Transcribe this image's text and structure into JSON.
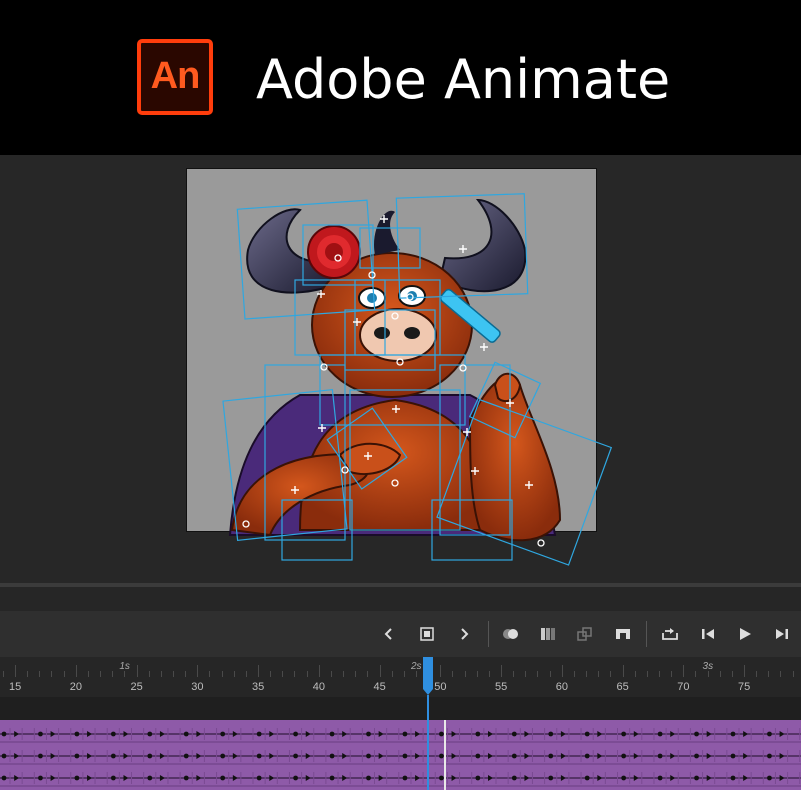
{
  "banner": {
    "logo_text": "An",
    "title": "Adobe Animate"
  },
  "toolbar": {
    "buttons": [
      "prev-frame-icon",
      "insert-keyframe-icon",
      "next-frame-icon",
      "onion-skin-icon",
      "edit-multiple-frames-icon",
      "sync-symbols-icon",
      "insert-frame-icon",
      "loop-icon",
      "step-back-icon",
      "play-icon",
      "step-forward-icon"
    ]
  },
  "timeline": {
    "seconds": [
      {
        "label": "1s",
        "frame": 24
      },
      {
        "label": "2s",
        "frame": 48
      },
      {
        "label": "3s",
        "frame": 72
      }
    ],
    "frame_labels": [
      "15",
      "20",
      "25",
      "30",
      "35",
      "40",
      "45",
      "50",
      "55",
      "60",
      "65",
      "70",
      "75"
    ],
    "first_frame": 15,
    "current_frame": 49
  },
  "colors": {
    "accent": "#2f8fe0",
    "track": "#8e5aa8",
    "brand": "#ff3d0c"
  }
}
